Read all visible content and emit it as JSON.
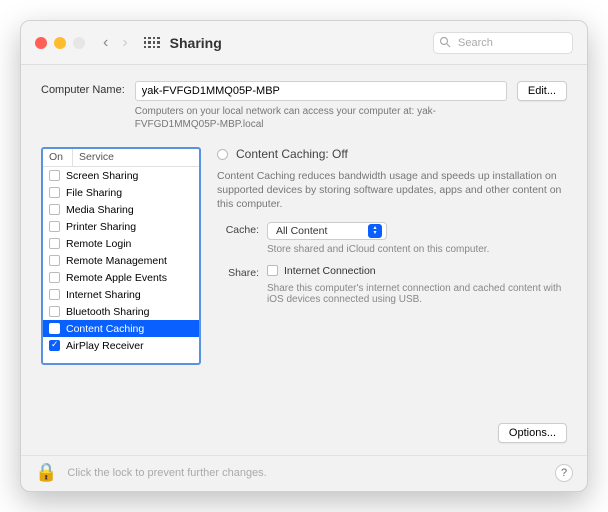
{
  "header": {
    "title": "Sharing",
    "search_placeholder": "Search"
  },
  "computer": {
    "label": "Computer Name:",
    "value": "yak-FVFGD1MMQ05P-MBP",
    "sub": "Computers on your local network can access your computer at: yak-FVFGD1MMQ05P-MBP.local",
    "edit": "Edit..."
  },
  "services": {
    "col_on": "On",
    "col_service": "Service",
    "items": [
      {
        "label": "Screen Sharing",
        "checked": false,
        "selected": false
      },
      {
        "label": "File Sharing",
        "checked": false,
        "selected": false
      },
      {
        "label": "Media Sharing",
        "checked": false,
        "selected": false
      },
      {
        "label": "Printer Sharing",
        "checked": false,
        "selected": false
      },
      {
        "label": "Remote Login",
        "checked": false,
        "selected": false
      },
      {
        "label": "Remote Management",
        "checked": false,
        "selected": false
      },
      {
        "label": "Remote Apple Events",
        "checked": false,
        "selected": false
      },
      {
        "label": "Internet Sharing",
        "checked": false,
        "selected": false
      },
      {
        "label": "Bluetooth Sharing",
        "checked": false,
        "selected": false
      },
      {
        "label": "Content Caching",
        "checked": false,
        "selected": true
      },
      {
        "label": "AirPlay Receiver",
        "checked": true,
        "selected": false
      }
    ]
  },
  "detail": {
    "title": "Content Caching: Off",
    "desc": "Content Caching reduces bandwidth usage and speeds up installation on supported devices by storing software updates, apps and other content on this computer.",
    "cache_label": "Cache:",
    "cache_value": "All Content",
    "cache_sub": "Store shared and iCloud content on this computer.",
    "share_label": "Share:",
    "share_value": "Internet Connection",
    "share_sub": "Share this computer's internet connection and cached content with iOS devices connected using USB.",
    "options": "Options..."
  },
  "footer": {
    "text": "Click the lock to prevent further changes.",
    "help": "?"
  }
}
